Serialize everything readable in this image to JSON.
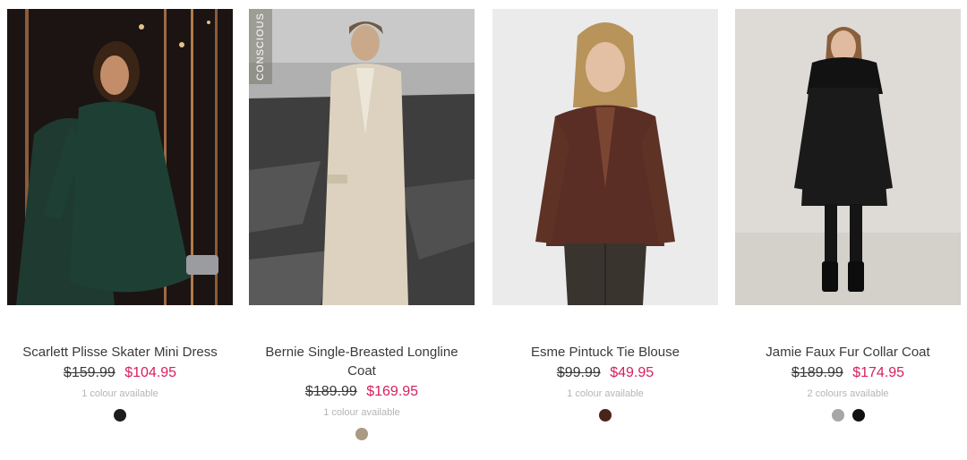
{
  "products": [
    {
      "name": "Scarlett Plisse Skater Mini Dress",
      "was_price": "$159.99",
      "now_price": "$104.95",
      "availability": "1 colour available",
      "swatches": [
        "#1c1c1c"
      ]
    },
    {
      "name": "Bernie Single-Breasted Longline Coat",
      "was_price": "$189.99",
      "now_price": "$169.95",
      "availability": "1 colour available",
      "tag": "CONSCIOUS",
      "swatches": [
        "#a99a82"
      ]
    },
    {
      "name": "Esme Pintuck Tie Blouse",
      "was_price": "$99.99",
      "now_price": "$49.95",
      "availability": "1 colour available",
      "swatches": [
        "#4a2419"
      ]
    },
    {
      "name": "Jamie Faux Fur Collar Coat",
      "was_price": "$189.99",
      "now_price": "$174.95",
      "availability": "2 colours available",
      "swatches": [
        "#a7a5a8",
        "#111111"
      ]
    }
  ],
  "colors": {
    "sale_price": "#d81e5b",
    "availability_text": "#b5b5b5"
  }
}
